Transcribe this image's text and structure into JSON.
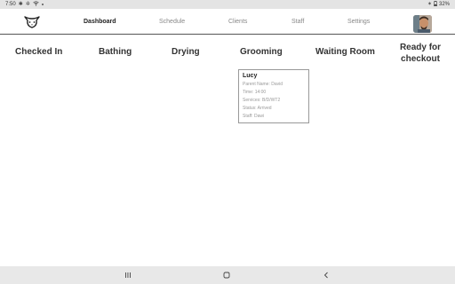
{
  "status_bar": {
    "time": "7:50",
    "battery": "32%"
  },
  "nav": {
    "items": [
      {
        "label": "Dashboard",
        "active": true
      },
      {
        "label": "Schedule",
        "active": false
      },
      {
        "label": "Clients",
        "active": false
      },
      {
        "label": "Staff",
        "active": false
      },
      {
        "label": "Settings",
        "active": false
      }
    ]
  },
  "board": {
    "columns": [
      {
        "title": "Checked In"
      },
      {
        "title": "Bathing"
      },
      {
        "title": "Drying"
      },
      {
        "title": "Grooming"
      },
      {
        "title": "Waiting Room"
      },
      {
        "title_line1": "Ready for",
        "title_line2": "checkout"
      }
    ],
    "cards": [
      {
        "column": "Grooming",
        "name": "Lucy",
        "parent": "Parent Name: David",
        "time": "Time: 14:00",
        "services": "Services: B/D/WT2",
        "status": "Status: Arrived",
        "staff": "Staff: Dawi"
      }
    ]
  },
  "colors": {
    "status_bar_bg": "#e4e4e4",
    "nav_bar_bg": "#e8e8e8",
    "divider": "#555555",
    "card_border": "#999999"
  },
  "icons": {
    "logo": "dog-face-logo-icon",
    "avatar": "user-avatar",
    "nav_buttons": [
      "recent-apps-icon",
      "home-icon",
      "back-icon"
    ]
  }
}
